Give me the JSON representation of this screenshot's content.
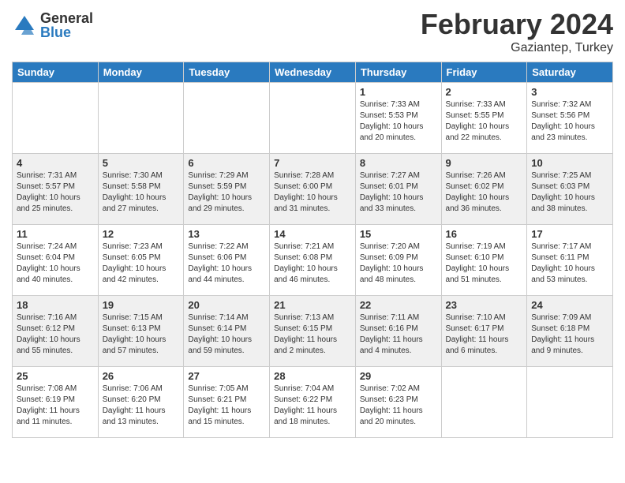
{
  "logo": {
    "general": "General",
    "blue": "Blue"
  },
  "header": {
    "month": "February 2024",
    "location": "Gaziantep, Turkey"
  },
  "weekdays": [
    "Sunday",
    "Monday",
    "Tuesday",
    "Wednesday",
    "Thursday",
    "Friday",
    "Saturday"
  ],
  "weeks": [
    [
      {
        "day": "",
        "sunrise": "",
        "sunset": "",
        "daylight": ""
      },
      {
        "day": "",
        "sunrise": "",
        "sunset": "",
        "daylight": ""
      },
      {
        "day": "",
        "sunrise": "",
        "sunset": "",
        "daylight": ""
      },
      {
        "day": "",
        "sunrise": "",
        "sunset": "",
        "daylight": ""
      },
      {
        "day": "1",
        "sunrise": "Sunrise: 7:33 AM",
        "sunset": "Sunset: 5:53 PM",
        "daylight": "Daylight: 10 hours and 20 minutes."
      },
      {
        "day": "2",
        "sunrise": "Sunrise: 7:33 AM",
        "sunset": "Sunset: 5:55 PM",
        "daylight": "Daylight: 10 hours and 22 minutes."
      },
      {
        "day": "3",
        "sunrise": "Sunrise: 7:32 AM",
        "sunset": "Sunset: 5:56 PM",
        "daylight": "Daylight: 10 hours and 23 minutes."
      }
    ],
    [
      {
        "day": "4",
        "sunrise": "Sunrise: 7:31 AM",
        "sunset": "Sunset: 5:57 PM",
        "daylight": "Daylight: 10 hours and 25 minutes."
      },
      {
        "day": "5",
        "sunrise": "Sunrise: 7:30 AM",
        "sunset": "Sunset: 5:58 PM",
        "daylight": "Daylight: 10 hours and 27 minutes."
      },
      {
        "day": "6",
        "sunrise": "Sunrise: 7:29 AM",
        "sunset": "Sunset: 5:59 PM",
        "daylight": "Daylight: 10 hours and 29 minutes."
      },
      {
        "day": "7",
        "sunrise": "Sunrise: 7:28 AM",
        "sunset": "Sunset: 6:00 PM",
        "daylight": "Daylight: 10 hours and 31 minutes."
      },
      {
        "day": "8",
        "sunrise": "Sunrise: 7:27 AM",
        "sunset": "Sunset: 6:01 PM",
        "daylight": "Daylight: 10 hours and 33 minutes."
      },
      {
        "day": "9",
        "sunrise": "Sunrise: 7:26 AM",
        "sunset": "Sunset: 6:02 PM",
        "daylight": "Daylight: 10 hours and 36 minutes."
      },
      {
        "day": "10",
        "sunrise": "Sunrise: 7:25 AM",
        "sunset": "Sunset: 6:03 PM",
        "daylight": "Daylight: 10 hours and 38 minutes."
      }
    ],
    [
      {
        "day": "11",
        "sunrise": "Sunrise: 7:24 AM",
        "sunset": "Sunset: 6:04 PM",
        "daylight": "Daylight: 10 hours and 40 minutes."
      },
      {
        "day": "12",
        "sunrise": "Sunrise: 7:23 AM",
        "sunset": "Sunset: 6:05 PM",
        "daylight": "Daylight: 10 hours and 42 minutes."
      },
      {
        "day": "13",
        "sunrise": "Sunrise: 7:22 AM",
        "sunset": "Sunset: 6:06 PM",
        "daylight": "Daylight: 10 hours and 44 minutes."
      },
      {
        "day": "14",
        "sunrise": "Sunrise: 7:21 AM",
        "sunset": "Sunset: 6:08 PM",
        "daylight": "Daylight: 10 hours and 46 minutes."
      },
      {
        "day": "15",
        "sunrise": "Sunrise: 7:20 AM",
        "sunset": "Sunset: 6:09 PM",
        "daylight": "Daylight: 10 hours and 48 minutes."
      },
      {
        "day": "16",
        "sunrise": "Sunrise: 7:19 AM",
        "sunset": "Sunset: 6:10 PM",
        "daylight": "Daylight: 10 hours and 51 minutes."
      },
      {
        "day": "17",
        "sunrise": "Sunrise: 7:17 AM",
        "sunset": "Sunset: 6:11 PM",
        "daylight": "Daylight: 10 hours and 53 minutes."
      }
    ],
    [
      {
        "day": "18",
        "sunrise": "Sunrise: 7:16 AM",
        "sunset": "Sunset: 6:12 PM",
        "daylight": "Daylight: 10 hours and 55 minutes."
      },
      {
        "day": "19",
        "sunrise": "Sunrise: 7:15 AM",
        "sunset": "Sunset: 6:13 PM",
        "daylight": "Daylight: 10 hours and 57 minutes."
      },
      {
        "day": "20",
        "sunrise": "Sunrise: 7:14 AM",
        "sunset": "Sunset: 6:14 PM",
        "daylight": "Daylight: 10 hours and 59 minutes."
      },
      {
        "day": "21",
        "sunrise": "Sunrise: 7:13 AM",
        "sunset": "Sunset: 6:15 PM",
        "daylight": "Daylight: 11 hours and 2 minutes."
      },
      {
        "day": "22",
        "sunrise": "Sunrise: 7:11 AM",
        "sunset": "Sunset: 6:16 PM",
        "daylight": "Daylight: 11 hours and 4 minutes."
      },
      {
        "day": "23",
        "sunrise": "Sunrise: 7:10 AM",
        "sunset": "Sunset: 6:17 PM",
        "daylight": "Daylight: 11 hours and 6 minutes."
      },
      {
        "day": "24",
        "sunrise": "Sunrise: 7:09 AM",
        "sunset": "Sunset: 6:18 PM",
        "daylight": "Daylight: 11 hours and 9 minutes."
      }
    ],
    [
      {
        "day": "25",
        "sunrise": "Sunrise: 7:08 AM",
        "sunset": "Sunset: 6:19 PM",
        "daylight": "Daylight: 11 hours and 11 minutes."
      },
      {
        "day": "26",
        "sunrise": "Sunrise: 7:06 AM",
        "sunset": "Sunset: 6:20 PM",
        "daylight": "Daylight: 11 hours and 13 minutes."
      },
      {
        "day": "27",
        "sunrise": "Sunrise: 7:05 AM",
        "sunset": "Sunset: 6:21 PM",
        "daylight": "Daylight: 11 hours and 15 minutes."
      },
      {
        "day": "28",
        "sunrise": "Sunrise: 7:04 AM",
        "sunset": "Sunset: 6:22 PM",
        "daylight": "Daylight: 11 hours and 18 minutes."
      },
      {
        "day": "29",
        "sunrise": "Sunrise: 7:02 AM",
        "sunset": "Sunset: 6:23 PM",
        "daylight": "Daylight: 11 hours and 20 minutes."
      },
      {
        "day": "",
        "sunrise": "",
        "sunset": "",
        "daylight": ""
      },
      {
        "day": "",
        "sunrise": "",
        "sunset": "",
        "daylight": ""
      }
    ]
  ]
}
